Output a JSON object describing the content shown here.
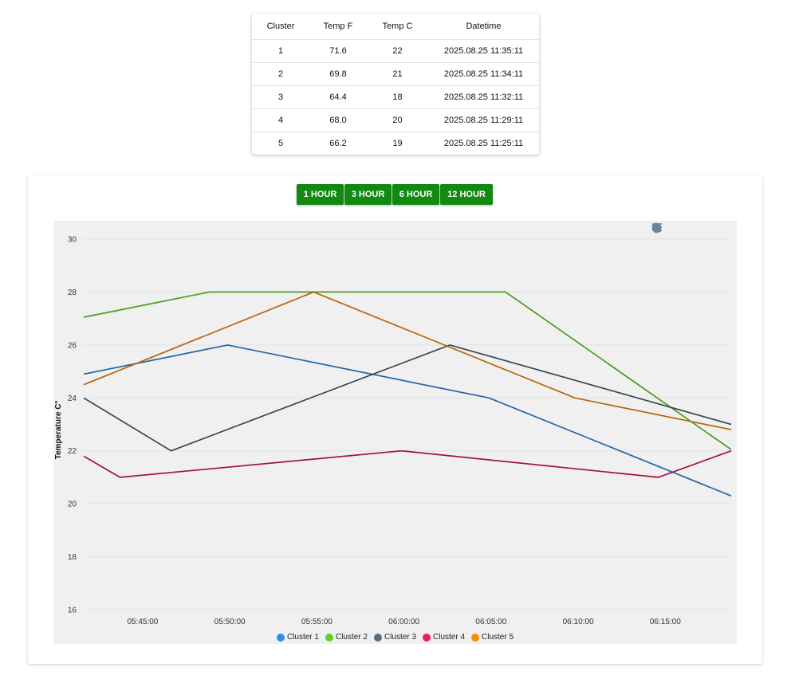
{
  "table": {
    "headers": [
      "Cluster",
      "Temp F",
      "Temp C",
      "Datetime"
    ],
    "rows": [
      [
        "1",
        "71.6",
        "22",
        "2025.08.25 11:35:11"
      ],
      [
        "2",
        "69.8",
        "21",
        "2025.08.25 11:34:11"
      ],
      [
        "3",
        "64.4",
        "18",
        "2025.08.25 11:32:11"
      ],
      [
        "4",
        "68.0",
        "20",
        "2025.08.25 11:29:11"
      ],
      [
        "5",
        "66.2",
        "19",
        "2025.08.25 11:25:11"
      ]
    ]
  },
  "range_buttons": [
    "1 HOUR",
    "3 HOUR",
    "6 HOUR",
    "12 HOUR"
  ],
  "range_button_color": "#128a12",
  "toolbar_icons": [
    "zoom-in-icon",
    "zoom-out-icon",
    "selection-zoom-icon",
    "pan-hand-icon",
    "home-icon",
    "menu-icon"
  ],
  "chart_data": {
    "type": "line",
    "ylabel": "Temperature C°",
    "xlabel": "",
    "ylim": [
      16,
      30
    ],
    "yticks": [
      16,
      18,
      20,
      22,
      24,
      26,
      28,
      30
    ],
    "xlim": [
      "05:41:37",
      "06:18:47"
    ],
    "xticks": [
      "05:45:00",
      "05:50:00",
      "05:55:00",
      "06:00:00",
      "06:05:00",
      "06:10:00",
      "06:15:00"
    ],
    "grid": true,
    "legend_position": "bottom",
    "series": [
      {
        "name": "Cluster 1",
        "color": "#2b8ee8",
        "line_color": "#2166ac",
        "points": [
          [
            "05:41:37",
            24.9
          ],
          [
            "05:49:53",
            26.0
          ],
          [
            "06:04:53",
            24.0
          ],
          [
            "06:18:47",
            20.3
          ]
        ]
      },
      {
        "name": "Cluster 2",
        "color": "#5fd31f",
        "line_color": "#4a9a1e",
        "points": [
          [
            "05:41:37",
            27.05
          ],
          [
            "05:48:50",
            28.0
          ],
          [
            "06:05:50",
            28.0
          ],
          [
            "06:18:47",
            22.05
          ]
        ]
      },
      {
        "name": "Cluster 3",
        "color": "#546e7a",
        "line_color": "#37474f",
        "points": [
          [
            "05:41:37",
            24.0
          ],
          [
            "05:46:38",
            22.0
          ],
          [
            "06:02:38",
            26.0
          ],
          [
            "06:18:47",
            23.0
          ]
        ]
      },
      {
        "name": "Cluster 4",
        "color": "#e91e63",
        "line_color": "#a3123f",
        "points": [
          [
            "05:41:37",
            21.8
          ],
          [
            "05:43:42",
            21.0
          ],
          [
            "05:59:52",
            22.0
          ],
          [
            "06:14:36",
            21.0
          ],
          [
            "06:18:47",
            22.0
          ]
        ]
      },
      {
        "name": "Cluster 5",
        "color": "#f39200",
        "line_color": "#b8650a",
        "points": [
          [
            "05:41:37",
            24.5
          ],
          [
            "05:54:49",
            28.0
          ],
          [
            "06:09:49",
            24.0
          ],
          [
            "06:18:47",
            22.8
          ]
        ]
      }
    ]
  }
}
